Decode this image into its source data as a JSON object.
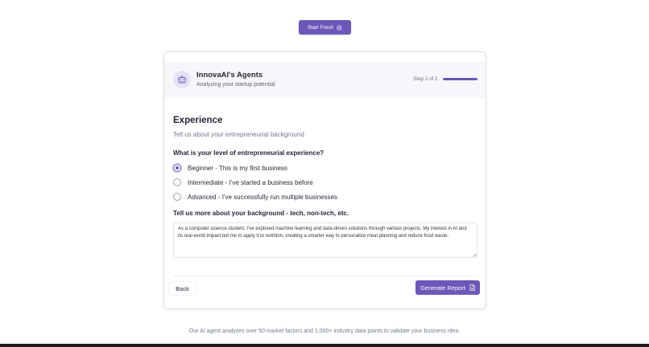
{
  "top": {
    "start_label": "Start Fresh",
    "start_icon": "check-circle-icon"
  },
  "header": {
    "avatar_icon": "robot-icon",
    "brand_title": "InnovaAI's Agents",
    "brand_subtitle": "Analyzing your startup potential",
    "step_text": "Step 2 of 2",
    "progress_fraction": 1.0
  },
  "section": {
    "title": "Experience",
    "subtitle": "Tell us about your entrepreneurial background"
  },
  "question1": {
    "label": "What is your level of entrepreneurial experience?",
    "options": [
      {
        "label": "Beginner - This is my first business",
        "checked": true
      },
      {
        "label": "Intermediate - I've started a business before",
        "checked": false
      },
      {
        "label": "Advanced - I've successfully run multiple businesses",
        "checked": false
      }
    ]
  },
  "question2": {
    "label": "Tell us more about your background - tech, non-tech, etc.",
    "value": "As a computer science student, I've explored machine learning and data-driven solutions through various projects. My interest in AI and its real-world impact led me to apply it to nutrition, creating a smarter way to personalize meal planning and reduce food waste."
  },
  "footer": {
    "back_label": "Back",
    "generate_label": "Generate Report",
    "generate_icon": "document-icon"
  },
  "bottom_text": "Our AI agent analyzes over 50 market factors and 1,000+ industry data points to validate your business idea.",
  "colors": {
    "accent": "#6b58b8",
    "accent_light": "#e6e1f6",
    "muted_text": "#6e7a8a"
  }
}
